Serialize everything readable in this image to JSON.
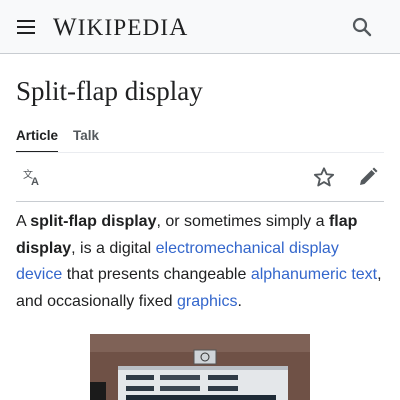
{
  "header": {
    "menu_icon": "hamburger-menu-icon",
    "wordmark_initial": "W",
    "wordmark_rest": "IKIPEDI",
    "wordmark_last": "A",
    "search_icon": "search-icon"
  },
  "page": {
    "title": "Split-flap display"
  },
  "tabs": [
    {
      "label": "Article",
      "active": true
    },
    {
      "label": "Talk",
      "active": false
    }
  ],
  "actions": {
    "language_icon": "language-icon",
    "watch_icon": "star-icon",
    "edit_icon": "pencil-icon"
  },
  "lead": {
    "t1": "A ",
    "b1": "split-flap display",
    "t2": ", or sometimes simply a ",
    "b2": "flap display",
    "t3": ", is a digital ",
    "l1": "electromechanical display device",
    "t4": " that presents changeable ",
    "l2": "alphanumeric text",
    "t5": ", and occasionally fixed ",
    "l3": "graphics",
    "t6": "."
  },
  "colors": {
    "link": "#3366cc",
    "text": "#202122",
    "header_bg": "#f8f9fa"
  }
}
